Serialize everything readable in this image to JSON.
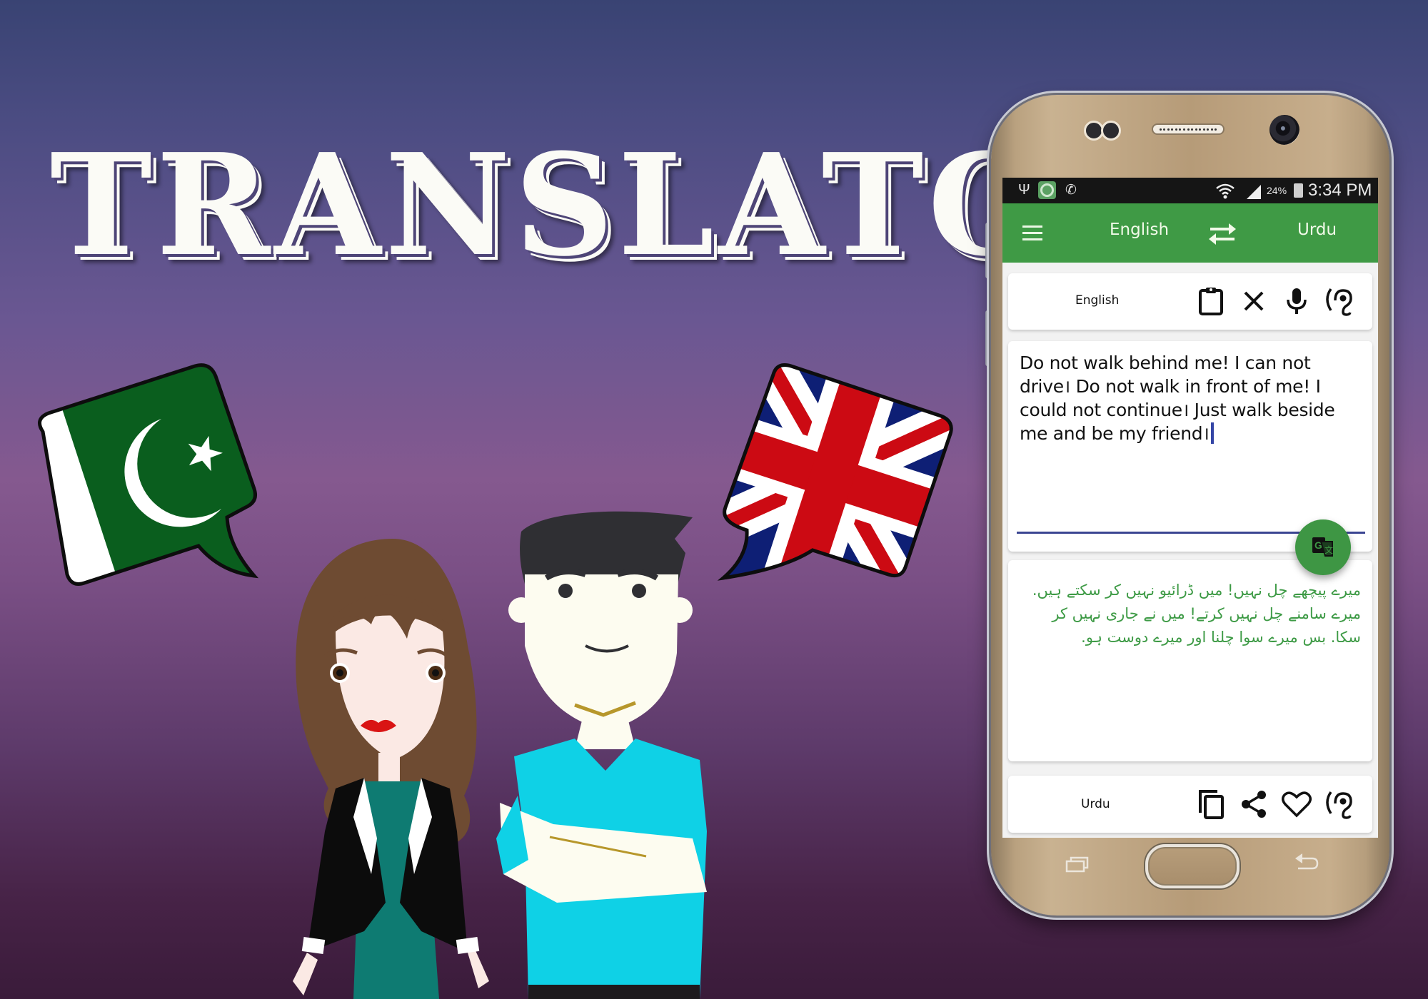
{
  "title": "TRANSLATOR",
  "flags": {
    "left": {
      "name": "Pakistan",
      "colors": {
        "green": "#0a5e1e",
        "white": "#ffffff"
      }
    },
    "right": {
      "name": "United Kingdom",
      "colors": {
        "blue": "#0e1f75",
        "red": "#cc0a13",
        "white": "#ffffff"
      }
    }
  },
  "characters": [
    "woman-in-blazer",
    "man-in-cyan-tshirt"
  ],
  "phone": {
    "status_bar": {
      "left_icons": [
        "usb-icon",
        "app-notification-icon",
        "call-alert-icon"
      ],
      "right_icons": [
        "wifi-icon",
        "signal-icon"
      ],
      "battery": "24%",
      "time": "3:34 PM"
    },
    "toolbar": {
      "menu_icon": "hamburger-menu-icon",
      "source_language": "English",
      "swap_icon": "swap-arrows-icon",
      "target_language": "Urdu",
      "color": "#3f9a45"
    },
    "source_panel": {
      "label": "English",
      "actions": [
        "Paste",
        "Clear",
        "Voice input",
        "Listen"
      ]
    },
    "input": {
      "value": "Do not walk behind me! I can not drive। Do not walk in front of me! I could not continue। Just walk beside me and be my friend।"
    },
    "translate_button": {
      "label": "Translate"
    },
    "output": {
      "value": "میرے پیچھے چل نہیں! میں ڈرائیو نہیں کر سکتے ہیں. میرے سامنے چل نہیں کرتے! میں نے جاری نہیں کر سکا. بس میرے سوا چلنا اور میرے دوست ہو.",
      "color": "#3d9a45"
    },
    "target_panel": {
      "label": "Urdu",
      "actions": [
        "Copy",
        "Share",
        "Favorite",
        "Listen"
      ]
    },
    "nav_keys": [
      "Recent apps",
      "Home",
      "Back"
    ]
  }
}
